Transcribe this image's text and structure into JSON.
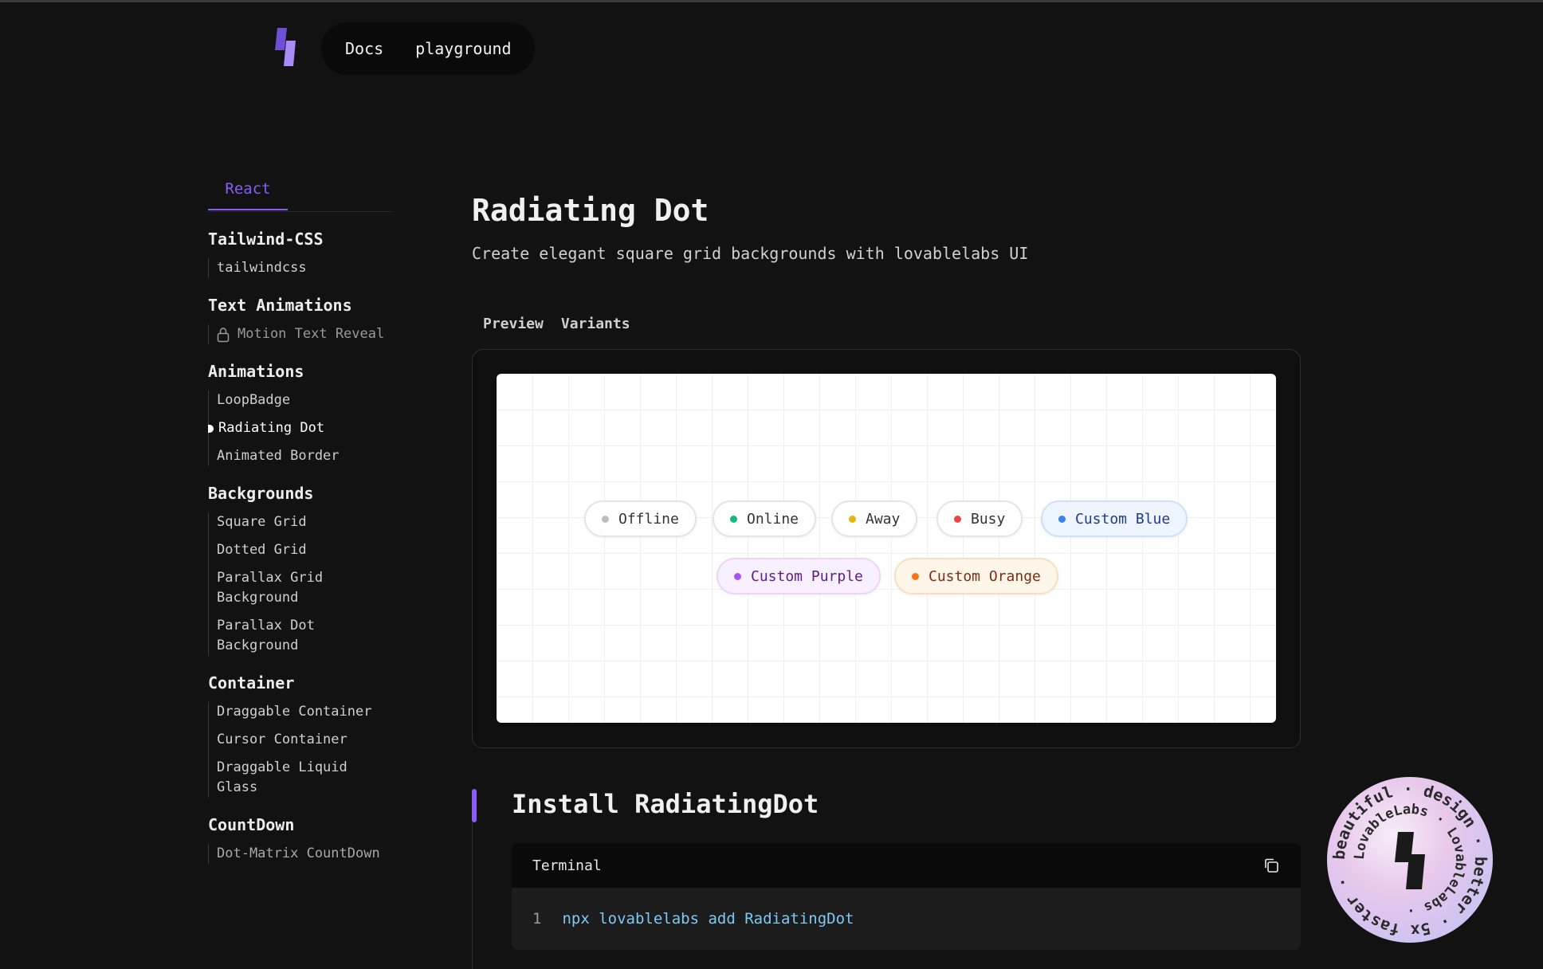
{
  "nav": {
    "docs": "Docs",
    "playground": "playground"
  },
  "sidebar": {
    "tab": "React",
    "sections": [
      {
        "title": "Tailwind-CSS",
        "items": [
          "tailwindcss"
        ]
      },
      {
        "title": "Text Animations",
        "items": [
          "Motion Text Reveal"
        ]
      },
      {
        "title": "Animations",
        "items": [
          "LoopBadge",
          "Radiating Dot",
          "Animated Border"
        ]
      },
      {
        "title": "Backgrounds",
        "items": [
          "Square Grid",
          "Dotted Grid",
          "Parallax Grid Background",
          "Parallax Dot Background"
        ]
      },
      {
        "title": "Container",
        "items": [
          "Draggable Container",
          "Cursor Container",
          "Draggable Liquid Glass"
        ]
      },
      {
        "title": "CountDown",
        "items": [
          "Dot-Matrix CountDown"
        ]
      }
    ]
  },
  "main": {
    "title": "Radiating Dot",
    "subtitle": "Create elegant square grid backgrounds with lovablelabs UI",
    "tabs": [
      "Preview",
      "Variants"
    ],
    "badges": [
      {
        "label": "Offline",
        "dot": "#bdbdbd",
        "bg": "#ffffff",
        "border": "#e5e5e5",
        "color": "#333333"
      },
      {
        "label": "Online",
        "dot": "#10b981",
        "bg": "#ffffff",
        "border": "#e5e5e5",
        "color": "#333333"
      },
      {
        "label": "Away",
        "dot": "#eab308",
        "bg": "#ffffff",
        "border": "#e5e5e5",
        "color": "#333333"
      },
      {
        "label": "Busy",
        "dot": "#ef4444",
        "bg": "#ffffff",
        "border": "#e5e5e5",
        "color": "#333333"
      },
      {
        "label": "Custom Blue",
        "dot": "#3b82f6",
        "bg": "#eef5ff",
        "border": "#cfe0fb",
        "color": "#1e3a8a"
      },
      {
        "label": "Custom Purple",
        "dot": "#a855f7",
        "bg": "#f8f0ff",
        "border": "#ead6fb",
        "color": "#5b1d8c"
      },
      {
        "label": "Custom Orange",
        "dot": "#f97316",
        "bg": "#fff6ea",
        "border": "#f7dfc0",
        "color": "#7c2d12"
      }
    ],
    "install_title": "Install RadiatingDot",
    "terminal": {
      "label": "Terminal",
      "line_number": "1",
      "command": "npx lovablelabs add RadiatingDot"
    }
  },
  "stamp": {
    "ring_text": "beautiful · design · better · 5x faster · ",
    "inner_text": "LovableLabs · LovableLabs · "
  },
  "colors": {
    "accent": "#8b5cf6",
    "background": "#121212"
  }
}
